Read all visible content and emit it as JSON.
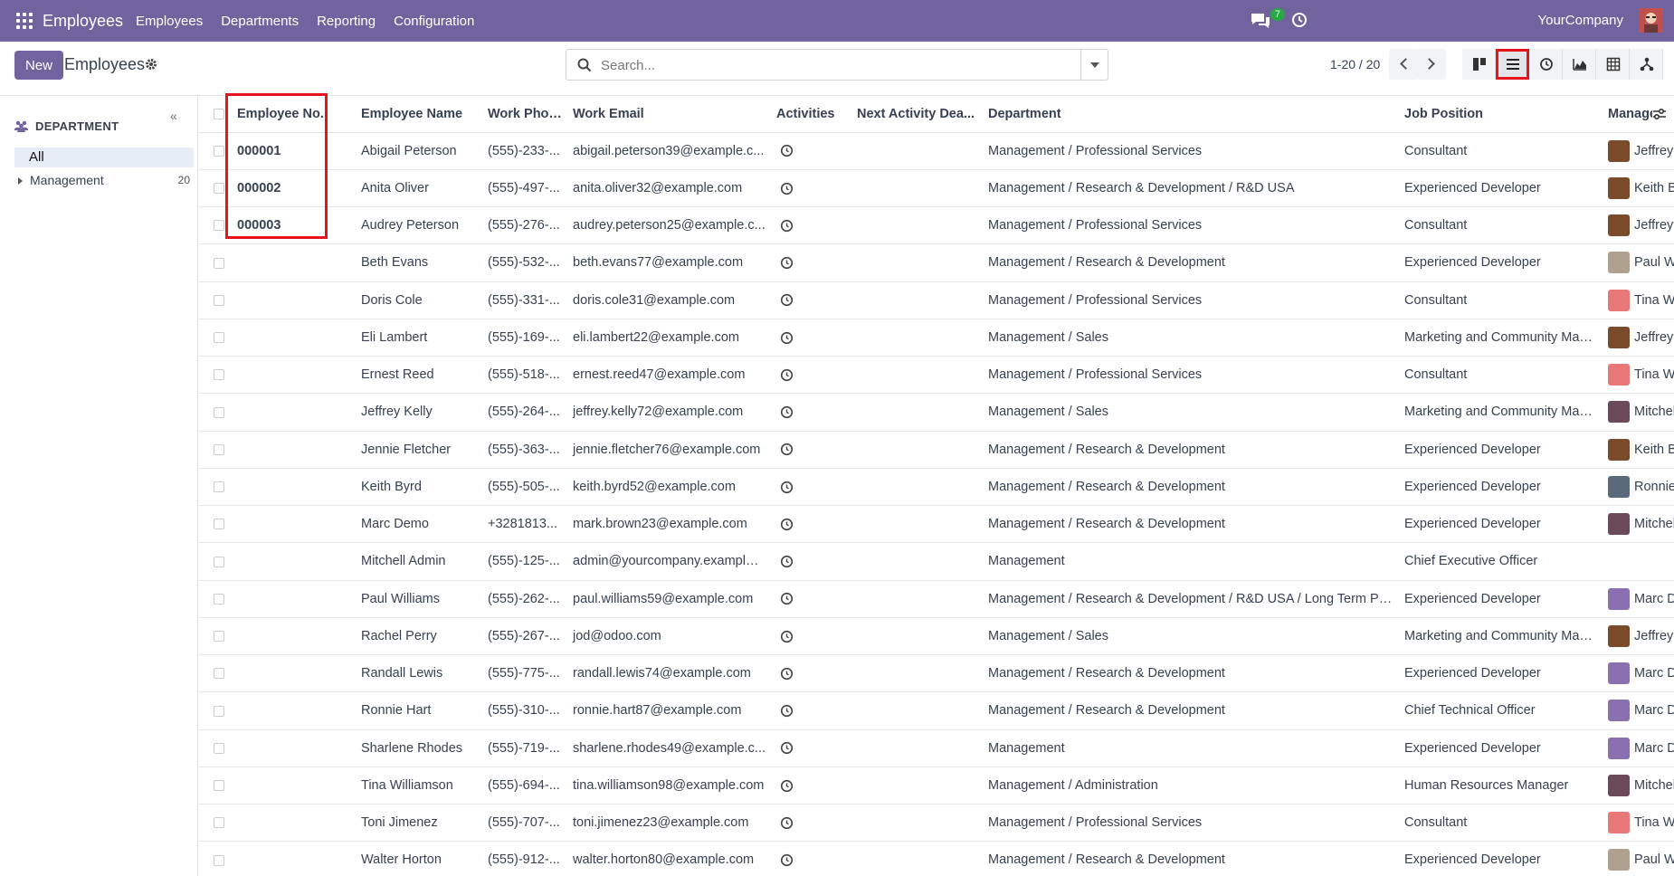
{
  "navbar": {
    "brand": "Employees",
    "menu": [
      "Employees",
      "Departments",
      "Reporting",
      "Configuration"
    ],
    "chat_count": "7",
    "company": "YourCompany"
  },
  "control": {
    "new_label": "New",
    "title": "Employees",
    "search_placeholder": "Search...",
    "pager": "1-20 / 20"
  },
  "sidebar": {
    "heading": "DEPARTMENT",
    "all_label": "All",
    "items": [
      {
        "label": "Management",
        "count": "20"
      }
    ]
  },
  "table": {
    "columns": [
      "Employee No.",
      "Employee Name",
      "Work Phone",
      "Work Email",
      "Activities",
      "Next Activity Dea...",
      "Department",
      "Job Position",
      "Manager"
    ],
    "rows": [
      {
        "no": "000001",
        "name": "Abigail Peterson",
        "phone": "(555)-233-...",
        "email": "abigail.peterson39@example.c...",
        "dept": "Management / Professional Services",
        "job": "Consultant",
        "manager": "Jeffrey Kelly",
        "mgr_color": "#7a4a2a"
      },
      {
        "no": "000002",
        "name": "Anita Oliver",
        "phone": "(555)-497-...",
        "email": "anita.oliver32@example.com",
        "dept": "Management / Research & Development / R&D USA",
        "job": "Experienced Developer",
        "manager": "Keith Byrd",
        "mgr_color": "#7a4a2a"
      },
      {
        "no": "000003",
        "name": "Audrey Peterson",
        "phone": "(555)-276-...",
        "email": "audrey.peterson25@example.c...",
        "dept": "Management / Professional Services",
        "job": "Consultant",
        "manager": "Jeffrey Kelly",
        "mgr_color": "#7a4a2a"
      },
      {
        "no": "",
        "name": "Beth Evans",
        "phone": "(555)-532-...",
        "email": "beth.evans77@example.com",
        "dept": "Management / Research & Development",
        "job": "Experienced Developer",
        "manager": "Paul Williams",
        "mgr_color": "#b0a090"
      },
      {
        "no": "",
        "name": "Doris Cole",
        "phone": "(555)-331-...",
        "email": "doris.cole31@example.com",
        "dept": "Management / Professional Services",
        "job": "Consultant",
        "manager": "Tina Williamson",
        "mgr_color": "#e87878"
      },
      {
        "no": "",
        "name": "Eli Lambert",
        "phone": "(555)-169-...",
        "email": "eli.lambert22@example.com",
        "dept": "Management / Sales",
        "job": "Marketing and Community Man...",
        "manager": "Jeffrey Kelly",
        "mgr_color": "#7a4a2a"
      },
      {
        "no": "",
        "name": "Ernest Reed",
        "phone": "(555)-518-...",
        "email": "ernest.reed47@example.com",
        "dept": "Management / Professional Services",
        "job": "Consultant",
        "manager": "Tina Williamson",
        "mgr_color": "#e87878"
      },
      {
        "no": "",
        "name": "Jeffrey Kelly",
        "phone": "(555)-264-...",
        "email": "jeffrey.kelly72@example.com",
        "dept": "Management / Sales",
        "job": "Marketing and Community Man...",
        "manager": "Mitchell Admin",
        "mgr_color": "#6b4a5a"
      },
      {
        "no": "",
        "name": "Jennie Fletcher",
        "phone": "(555)-363-...",
        "email": "jennie.fletcher76@example.com",
        "dept": "Management / Research & Development",
        "job": "Experienced Developer",
        "manager": "Keith Byrd",
        "mgr_color": "#7a4a2a"
      },
      {
        "no": "",
        "name": "Keith Byrd",
        "phone": "(555)-505-...",
        "email": "keith.byrd52@example.com",
        "dept": "Management / Research & Development",
        "job": "Experienced Developer",
        "manager": "Ronnie Hart",
        "mgr_color": "#5a6a7a"
      },
      {
        "no": "",
        "name": "Marc Demo",
        "phone": "+3281813...",
        "email": "mark.brown23@example.com",
        "dept": "Management / Research & Development",
        "job": "Experienced Developer",
        "manager": "Mitchell Admin",
        "mgr_color": "#6b4a5a"
      },
      {
        "no": "",
        "name": "Mitchell Admin",
        "phone": "(555)-125-...",
        "email": "admin@yourcompany.example....",
        "dept": "Management",
        "job": "Chief Executive Officer",
        "manager": "",
        "mgr_color": ""
      },
      {
        "no": "",
        "name": "Paul Williams",
        "phone": "(555)-262-...",
        "email": "paul.williams59@example.com",
        "dept": "Management / Research & Development / R&D USA / Long Term Proj...",
        "job": "Experienced Developer",
        "manager": "Marc Demo",
        "mgr_color": "#8a70b0"
      },
      {
        "no": "",
        "name": "Rachel Perry",
        "phone": "(555)-267-...",
        "email": "jod@odoo.com",
        "dept": "Management / Sales",
        "job": "Marketing and Community Man...",
        "manager": "Jeffrey Kelly",
        "mgr_color": "#7a4a2a"
      },
      {
        "no": "",
        "name": "Randall Lewis",
        "phone": "(555)-775-...",
        "email": "randall.lewis74@example.com",
        "dept": "Management / Research & Development",
        "job": "Experienced Developer",
        "manager": "Marc Demo",
        "mgr_color": "#8a70b0"
      },
      {
        "no": "",
        "name": "Ronnie Hart",
        "phone": "(555)-310-...",
        "email": "ronnie.hart87@example.com",
        "dept": "Management / Research & Development",
        "job": "Chief Technical Officer",
        "manager": "Marc Demo",
        "mgr_color": "#8a70b0"
      },
      {
        "no": "",
        "name": "Sharlene Rhodes",
        "phone": "(555)-719-...",
        "email": "sharlene.rhodes49@example.c...",
        "dept": "Management",
        "job": "Experienced Developer",
        "manager": "Marc Demo",
        "mgr_color": "#8a70b0"
      },
      {
        "no": "",
        "name": "Tina Williamson",
        "phone": "(555)-694-...",
        "email": "tina.williamson98@example.com",
        "dept": "Management / Administration",
        "job": "Human Resources Manager",
        "manager": "Mitchell Admin",
        "mgr_color": "#6b4a5a"
      },
      {
        "no": "",
        "name": "Toni Jimenez",
        "phone": "(555)-707-...",
        "email": "toni.jimenez23@example.com",
        "dept": "Management / Professional Services",
        "job": "Consultant",
        "manager": "Tina Williamson",
        "mgr_color": "#e87878"
      },
      {
        "no": "",
        "name": "Walter Horton",
        "phone": "(555)-912-...",
        "email": "walter.horton80@example.com",
        "dept": "Management / Research & Development",
        "job": "Experienced Developer",
        "manager": "Paul Williams",
        "mgr_color": "#b0a090"
      }
    ]
  },
  "colors": {
    "brand": "#71639e",
    "highlight": "#e8141c",
    "badge": "#28a745"
  }
}
